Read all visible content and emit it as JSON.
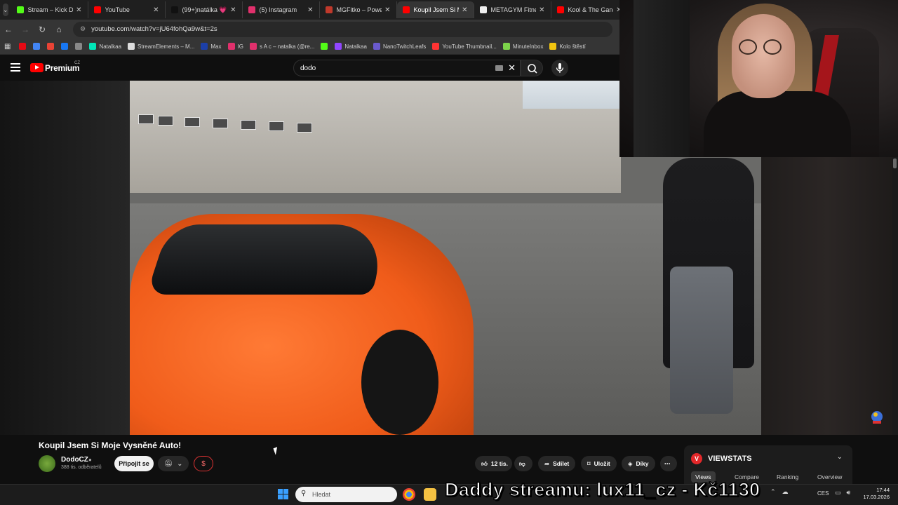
{
  "browser": {
    "tabs": [
      {
        "label": "Stream – Kick Dash",
        "color": "#53fc18"
      },
      {
        "label": "YouTube",
        "color": "#ff0000"
      },
      {
        "label": "(99+)natálka 💗 (",
        "color": "#111111"
      },
      {
        "label": "(5) Instagram",
        "color": "#e1306c"
      },
      {
        "label": "MGFitko – Power",
        "color": "#c0392b"
      },
      {
        "label": "Koupil Jsem Si M",
        "color": "#ff0000",
        "active": true
      },
      {
        "label": "METAGYM Fitness",
        "color": "#eeeeee"
      },
      {
        "label": "Kool & The Gang",
        "color": "#ff0000"
      }
    ],
    "url": "youtube.com/watch?v=jU64fohQa9w&t=2s",
    "bookmarks": [
      {
        "label": "",
        "color": "#e50914"
      },
      {
        "label": "",
        "color": "#4285f4"
      },
      {
        "label": "",
        "color": "#ea4335"
      },
      {
        "label": "",
        "color": "#1877f2"
      },
      {
        "label": "",
        "color": "#888888"
      },
      {
        "label": "Natalkaa",
        "color": "#00e6b8"
      },
      {
        "label": "StreamElements – M...",
        "color": "#dddddd"
      },
      {
        "label": "Max",
        "color": "#1c3fa8"
      },
      {
        "label": "IG",
        "color": "#e1306c"
      },
      {
        "label": "s A c – natalka (@re...",
        "color": "#e1306c"
      },
      {
        "label": "",
        "color": "#53fc18"
      },
      {
        "label": "Natalkaa",
        "color": "#9146ff"
      },
      {
        "label": "NanoTwitchLeafs",
        "color": "#6a5acd"
      },
      {
        "label": "YouTube Thumbnail...",
        "color": "#ff3333"
      },
      {
        "label": "MinuteInbox",
        "color": "#7cd34a"
      },
      {
        "label": "Kolo štěstí",
        "color": "#f1c40f"
      }
    ]
  },
  "youtube": {
    "brand": "Premium",
    "region": "CZ",
    "search_value": "dodo",
    "video_title": "Koupil Jsem Si Moje Vysněné Auto!",
    "channel": {
      "name": "DodoCZ",
      "subscribers": "388 tis. odběratelů",
      "join_label": "Připojit se"
    },
    "actions": {
      "likes": "12 tis.",
      "share": "Sdílet",
      "save": "Uložit",
      "thanks": "Díky"
    }
  },
  "viewstats": {
    "title": "VIEWSTATS",
    "tabs": [
      "Views",
      "Compare",
      "Ranking",
      "Overview"
    ],
    "active_tab": "Views"
  },
  "overlay": {
    "donation_text": "Daddy streamu: lux11_cz - Kč1130"
  },
  "taskbar": {
    "search_placeholder": "Hledat",
    "language": "CES",
    "time": "17:44",
    "date": "17.03.2026"
  },
  "colors": {
    "youtube_red": "#ff0000",
    "background": "#0f0f0f",
    "viewstats_red": "#e3282a"
  }
}
